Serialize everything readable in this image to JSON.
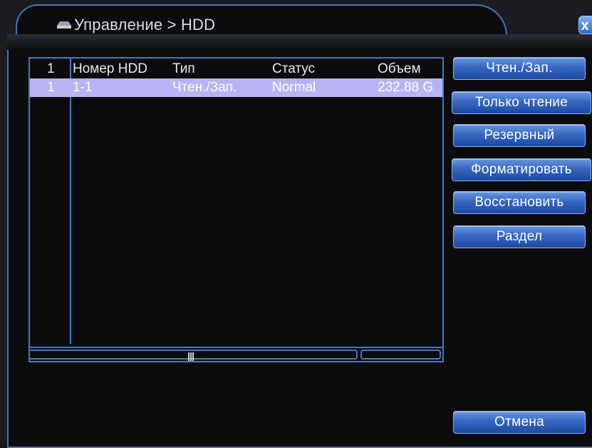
{
  "window": {
    "title": "Управление > HDD",
    "close_label": "x"
  },
  "table": {
    "headers": [
      "1",
      "Номер HDD",
      "Тип",
      "Статус",
      "Объем"
    ],
    "rows": [
      {
        "index": "1",
        "number": "1-1",
        "type": "Чтен./Зап.",
        "status": "Normal",
        "capacity": "232.88 G"
      }
    ]
  },
  "buttons": {
    "read_write": "Чтен./Зап.",
    "read_only": "Только чтение",
    "redundant": "Резервный",
    "format": "Форматировать",
    "recover": "Восстановить",
    "partition": "Раздел",
    "cancel": "Отмена"
  },
  "colors": {
    "accent": "#4f74b4",
    "selected_row": "#b9b3f5",
    "button": "#3567c1"
  }
}
